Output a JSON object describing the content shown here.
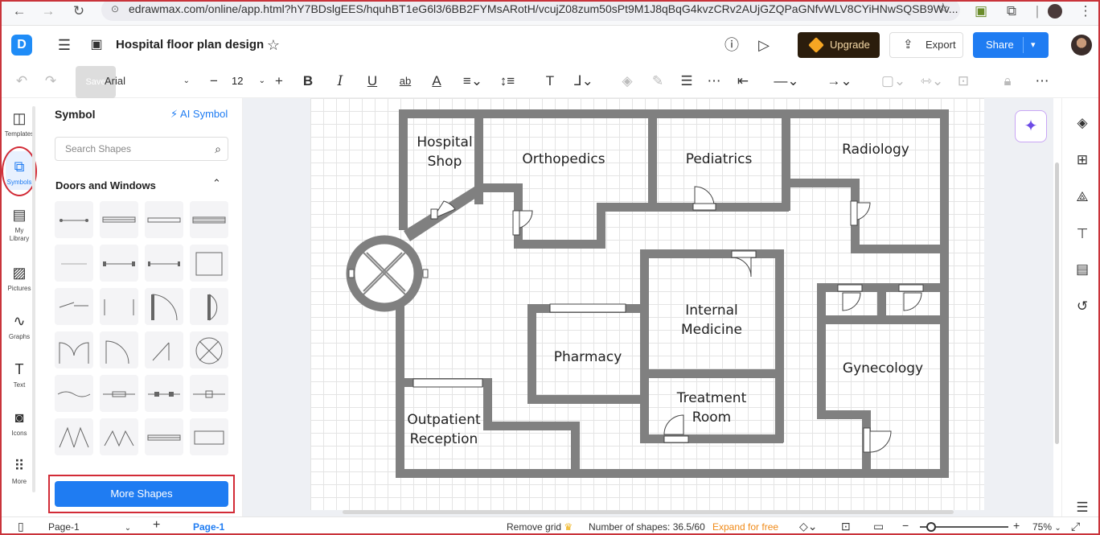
{
  "browser": {
    "url": "edrawmax.com/online/app.html?hY7BDslgEES/hquhBT1eG6l3/6BB2FYMsARotH/vcujZ08zum50sPt9M1J8qBqG4kvzCRv2AUjGZQPaGNfvWLV8CYiHNwSQSB9Wv..."
  },
  "header": {
    "title": "Hospital floor plan design",
    "upgrade_label": "Upgrade",
    "export_label": "Export",
    "share_label": "Share"
  },
  "toolbar": {
    "save_label": "Save",
    "font": "Arial",
    "font_size": "12"
  },
  "rail": {
    "items": [
      "Templates",
      "Symbols",
      "My Library",
      "Pictures",
      "Graphs",
      "Text",
      "Icons",
      "More"
    ]
  },
  "panel": {
    "title": "Symbol",
    "ai_symbol": "AI Symbol",
    "search_placeholder": "Search Shapes",
    "section": "Doors and Windows",
    "more_shapes": "More Shapes"
  },
  "rooms": {
    "hospital_shop_1": "Hospital",
    "hospital_shop_2": "Shop",
    "orthopedics": "Orthopedics",
    "pediatrics": "Pediatrics",
    "radiology": "Radiology",
    "internal_medicine_1": "Internal",
    "internal_medicine_2": "Medicine",
    "pharmacy": "Pharmacy",
    "gynecology": "Gynecology",
    "treatment_room_1": "Treatment",
    "treatment_room_2": "Room",
    "outpatient_1": "Outpatient",
    "outpatient_2": "Reception"
  },
  "status": {
    "page_select": "Page-1",
    "page_tab": "Page-1",
    "remove_grid": "Remove grid",
    "shape_count": "Number of shapes: 36.5/60",
    "expand": "Expand for free",
    "zoom": "75%"
  },
  "colors": {
    "accent": "#1f7cf2",
    "wall": "#808080",
    "highlight": "#d22b36",
    "upgrade_bg": "#2b1d0c"
  }
}
